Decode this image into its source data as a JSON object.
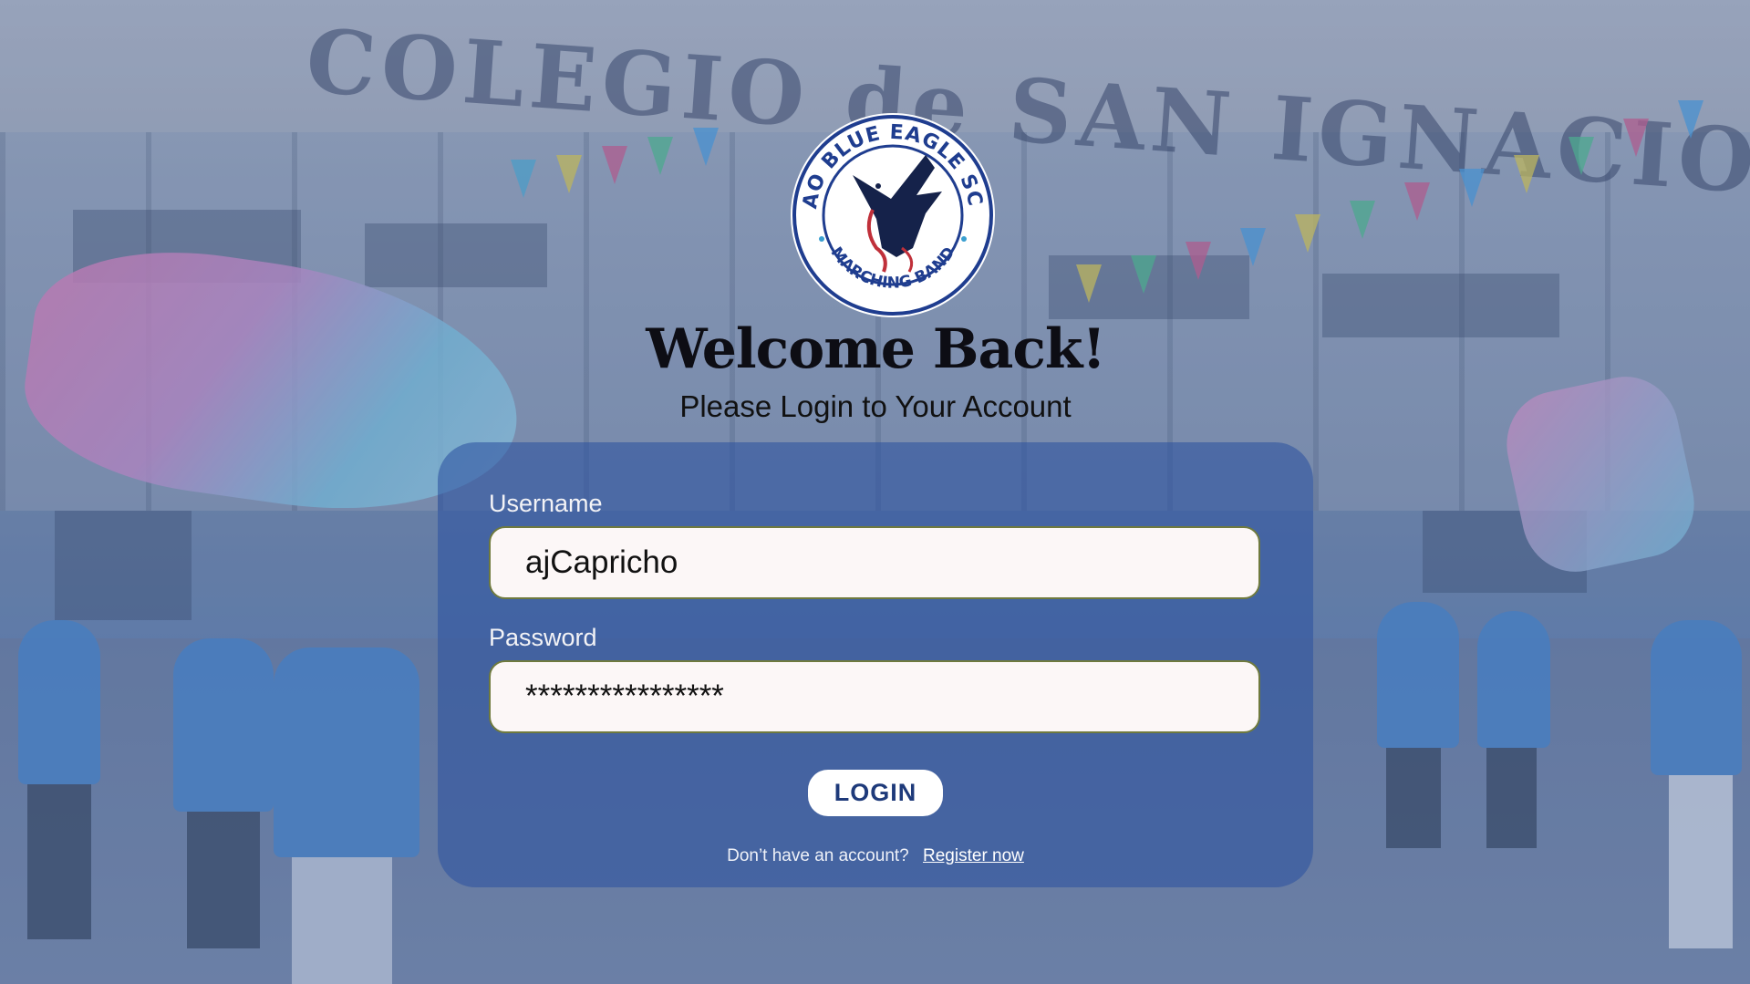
{
  "header": {
    "title": "Welcome Back!",
    "subtitle": "Please Login to Your Account"
  },
  "logo": {
    "text_top": "DAVAO BLUE EAGLE SCOUT",
    "text_bottom": "MARCHING BAND"
  },
  "form": {
    "username_label": "Username",
    "username_value": "ajCapricho",
    "password_label": "Password",
    "password_value": "****************",
    "login_label": "LOGIN",
    "register_prompt": "Don’t have an account?",
    "register_link": "Register now"
  },
  "background": {
    "sign_text": "COLEGIO de SAN IGNACIO, INC"
  },
  "colors": {
    "card": "#2c52a0",
    "button_text": "#1e3a7a",
    "field_border": "#6f7a3e"
  }
}
